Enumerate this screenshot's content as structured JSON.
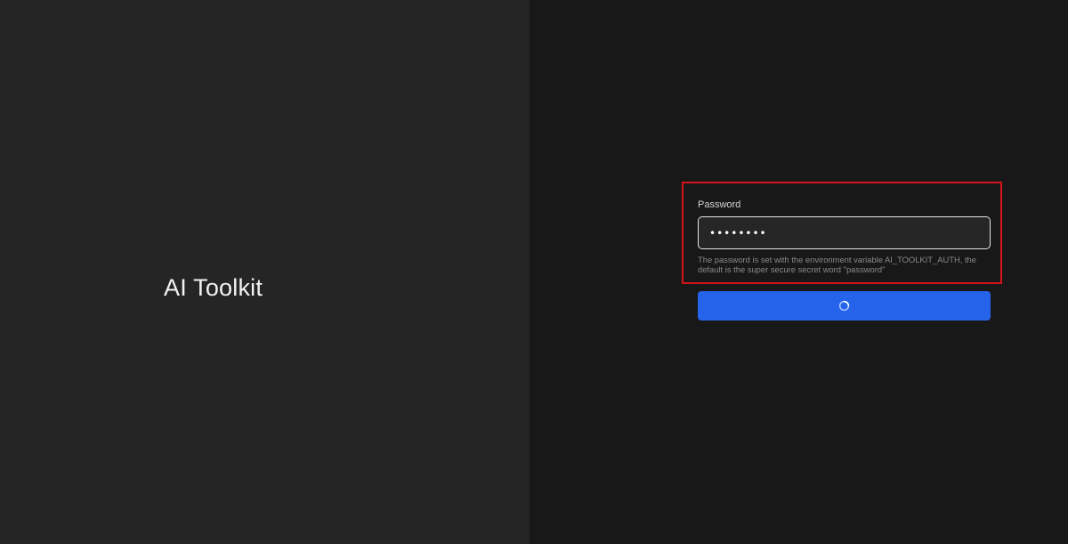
{
  "branding": {
    "title": "AI Toolkit"
  },
  "login_form": {
    "password_label": "Password",
    "password_value": "••••••••",
    "help_text": "The password is set with the environment variable AI_TOOLKIT_AUTH, the default is the super secure secret word \"password\"",
    "submit_state": "loading"
  },
  "colors": {
    "left_background": "#252525",
    "right_background": "#181818",
    "input_background": "#262626",
    "input_border": "#e6e6e6",
    "button_color": "#2563eb",
    "highlight_color": "#d4141b",
    "spinner_track": "#9fc2ff",
    "spinner_arc": "#ffffff"
  },
  "icons": {
    "submit_button": "loading-spinner-icon"
  }
}
